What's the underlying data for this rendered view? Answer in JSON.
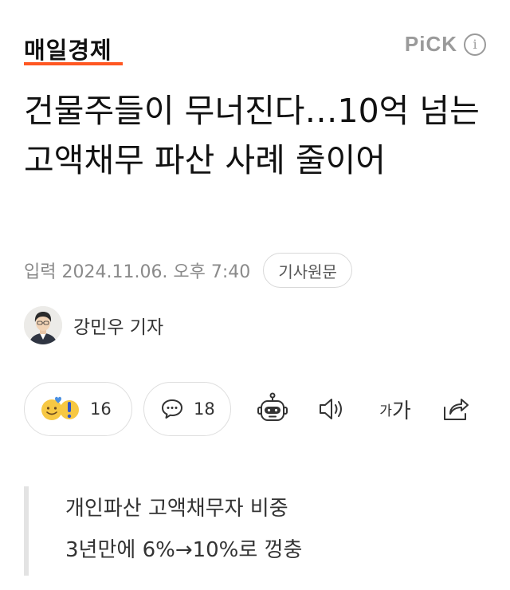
{
  "header": {
    "brand": "매일경제",
    "pick_label": "PiCK",
    "info_icon": "i",
    "accent_color": "#ff5722"
  },
  "article": {
    "title": "건물주들이 무너진다…10억 넘는 고액채무 파산 사례 줄이어",
    "date": "입력 2024.11.06. 오후 7:40",
    "original_button": "기사원문"
  },
  "author": {
    "name": "강민우 기자",
    "avatar_icon": "reporter-photo"
  },
  "actions": {
    "reaction_count": "16",
    "comment_count": "18",
    "summary_icon": "robot-icon",
    "speaker_icon": "speaker-icon",
    "font_small": "가",
    "font_large": "가",
    "share_icon": "share-icon"
  },
  "subtitle": {
    "lines": [
      "개인파산 고액채무자 비중",
      "3년만에 6%→10%로 껑충"
    ]
  }
}
